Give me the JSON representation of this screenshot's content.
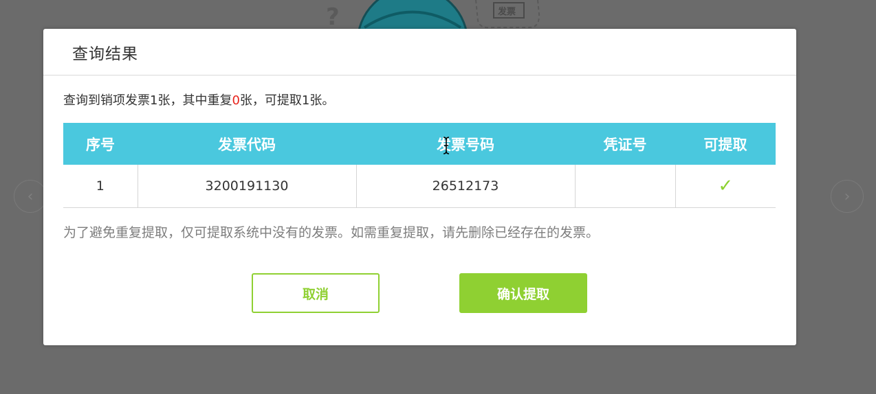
{
  "background": {
    "badge_label": "发票",
    "prev_arrow": "‹",
    "next_arrow": "›"
  },
  "dialog": {
    "title": "查询结果",
    "summary": {
      "prefix": "查询到销项发票1张，其中重复",
      "duplicate_count": "0",
      "suffix": "张，可提取1张。"
    },
    "table": {
      "headers": [
        "序号",
        "发票代码",
        "发票号码",
        "凭证号",
        "可提取"
      ],
      "rows": [
        {
          "index": "1",
          "invoice_code": "3200191130",
          "invoice_number": "26512173",
          "voucher_no": "",
          "extractable": "✓"
        }
      ]
    },
    "note": "为了避免重复提取，仅可提取系统中没有的发票。如需重复提取，请先删除已经存在的发票。",
    "buttons": {
      "cancel": "取消",
      "confirm": "确认提取"
    }
  },
  "colors": {
    "accent_green": "#8fd032",
    "header_cyan": "#4ac8de",
    "highlight_red": "#e8231c"
  }
}
